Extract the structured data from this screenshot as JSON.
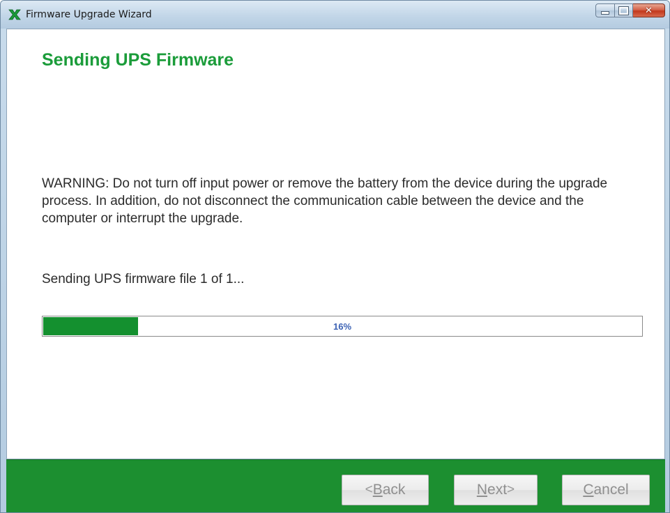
{
  "window": {
    "title": "Firmware Upgrade Wizard",
    "icon": "green-x-app-icon",
    "controls": {
      "minimize": "minimize-icon",
      "maximize": "maximize-icon",
      "close": "close-icon"
    }
  },
  "page": {
    "title": "Sending UPS Firmware",
    "warning": "WARNING: Do not turn off input power or remove the battery from the device during the upgrade process. In addition, do not disconnect the communication cable between the device and the computer or interrupt the upgrade.",
    "status": "Sending UPS firmware file 1 of 1..."
  },
  "progress": {
    "value": 0.16,
    "label": "16%"
  },
  "buttons": {
    "back": {
      "arrow": "<",
      "accel": "B",
      "rest": "ack",
      "enabled": false
    },
    "next": {
      "accel": "N",
      "rest": "ext",
      "arrow": ">",
      "enabled": false
    },
    "cancel": {
      "accel": "C",
      "rest": "ancel",
      "enabled": false
    }
  },
  "colors": {
    "brand_green": "#1b9c3a",
    "footer_green": "#1c8f30",
    "progress_fill": "#14902f",
    "progress_label": "#3c62b4"
  }
}
